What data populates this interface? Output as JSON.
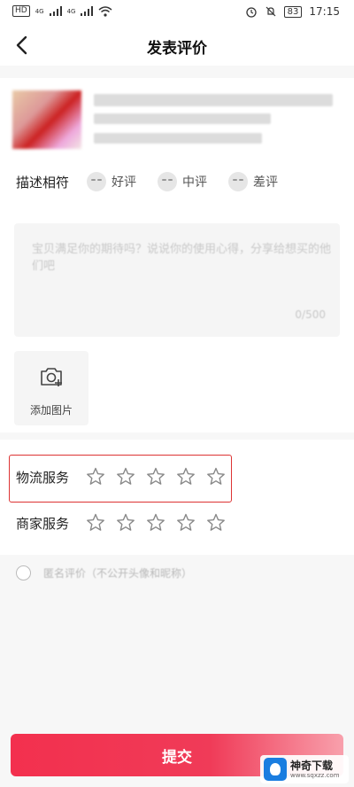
{
  "status_bar": {
    "network_left": "HD",
    "network_tags": [
      "4G",
      "4G"
    ],
    "battery": "83",
    "time": "17:15"
  },
  "header": {
    "title": "发表评价",
    "back_icon": "chevron-left-icon"
  },
  "product_rating": {
    "label": "描述相符",
    "options": [
      {
        "label": "好评",
        "icon": "happy-face-icon"
      },
      {
        "label": "中评",
        "icon": "neutral-face-icon"
      },
      {
        "label": "差评",
        "icon": "sad-face-icon"
      }
    ]
  },
  "comment": {
    "placeholder": "宝贝满足你的期待吗？说说你的使用心得，分享给想买的他们吧",
    "counter": "0/500"
  },
  "photo": {
    "label": "添加图片",
    "icon": "camera-add-icon"
  },
  "services": [
    {
      "label": "物流服务",
      "stars": 0,
      "max": 5
    },
    {
      "label": "商家服务",
      "stars": 0,
      "max": 5
    }
  ],
  "anonymous": {
    "label": "匿名评价（不公开头像和昵称）"
  },
  "submit": {
    "label": "提交"
  },
  "watermark": {
    "title": "神奇下载",
    "url": "www.sqxzz.com"
  },
  "colors": {
    "accent": "#f3304e",
    "highlight_border": "#d33333"
  }
}
